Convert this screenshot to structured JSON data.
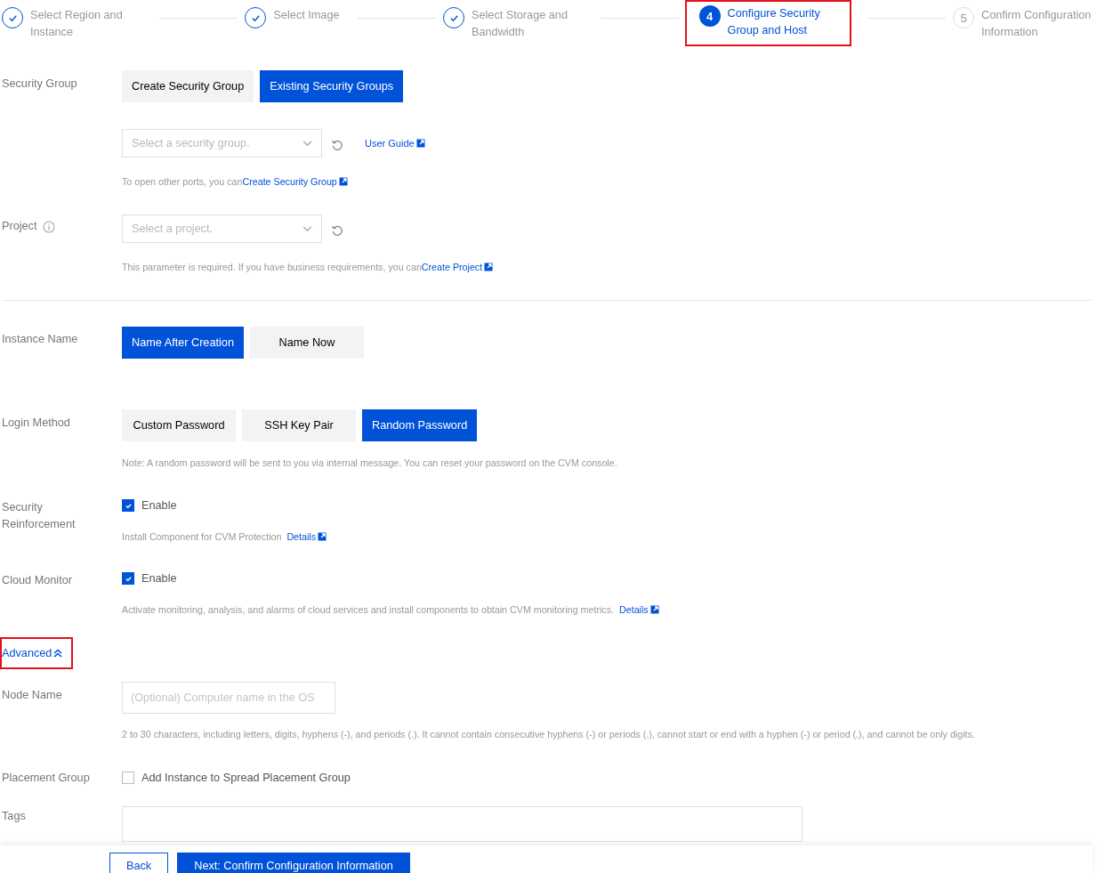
{
  "steps": [
    {
      "label": "Select Region and Instance",
      "kind": "done",
      "highlighted": false
    },
    {
      "label": "Select Image",
      "kind": "done",
      "highlighted": false
    },
    {
      "label": "Select Storage and Bandwidth",
      "kind": "done",
      "highlighted": false
    },
    {
      "number": "4",
      "label": "Configure Security Group and Host",
      "kind": "current",
      "highlighted": true
    },
    {
      "number": "5",
      "label": "Confirm Configuration Information",
      "kind": "pending",
      "highlighted": false
    }
  ],
  "security_group": {
    "label": "Security Group",
    "options": [
      {
        "label": "Create Security Group",
        "selected": false
      },
      {
        "label": "Existing Security Groups",
        "selected": true
      }
    ],
    "select": {
      "placeholder": "Select a security group."
    },
    "guide_link": "User Guide",
    "note": "To open other ports, you can",
    "note_link": "Create Security Group"
  },
  "project": {
    "label": "Project",
    "select": {
      "placeholder": "Select a project."
    },
    "note": "This parameter is required. If you have business requirements, you can",
    "note_link": "Create Project"
  },
  "instance_name": {
    "label": "Instance Name",
    "options": [
      {
        "label": "Name After Creation",
        "selected": true
      },
      {
        "label": "Name Now",
        "selected": false
      }
    ]
  },
  "login_method": {
    "label": "Login Method",
    "options": [
      {
        "label": "Custom Password",
        "selected": false
      },
      {
        "label": "SSH Key Pair",
        "selected": false
      },
      {
        "label": "Random Password",
        "selected": true
      }
    ],
    "note": "Note: A random password will be sent to you via internal message. You can reset your password on the CVM console."
  },
  "security_reinforcement": {
    "label": "Security Reinforcement",
    "checkbox": {
      "label": "Enable",
      "checked": true
    },
    "note": "Install Component for CVM Protection",
    "note_link": "Details"
  },
  "cloud_monitor": {
    "label": "Cloud Monitor",
    "checkbox": {
      "label": "Enable",
      "checked": true
    },
    "note": "Activate monitoring, analysis, and alarms of cloud services and install components to obtain CVM monitoring metrics.",
    "note_link": "Details"
  },
  "advanced": {
    "label": "Advanced",
    "expanded": true,
    "highlighted": true
  },
  "node_name": {
    "label": "Node Name",
    "input": {
      "placeholder": "(Optional) Computer name in the OS"
    },
    "note": "2 to 30 characters, including letters, digits, hyphens (-), and periods (.). It cannot contain consecutive hyphens (-) or periods (.), cannot start or end with a hyphen (-) or period (.), and cannot be only digits."
  },
  "placement_group": {
    "label": "Placement Group",
    "checkbox": {
      "label": "Add Instance to Spread Placement Group",
      "checked": false
    }
  },
  "tags": {
    "label": "Tags"
  },
  "footer": {
    "buttons": [
      {
        "label": "Back",
        "kind": "secondary"
      },
      {
        "label": "Next: Confirm Configuration Information",
        "kind": "primary"
      }
    ]
  }
}
